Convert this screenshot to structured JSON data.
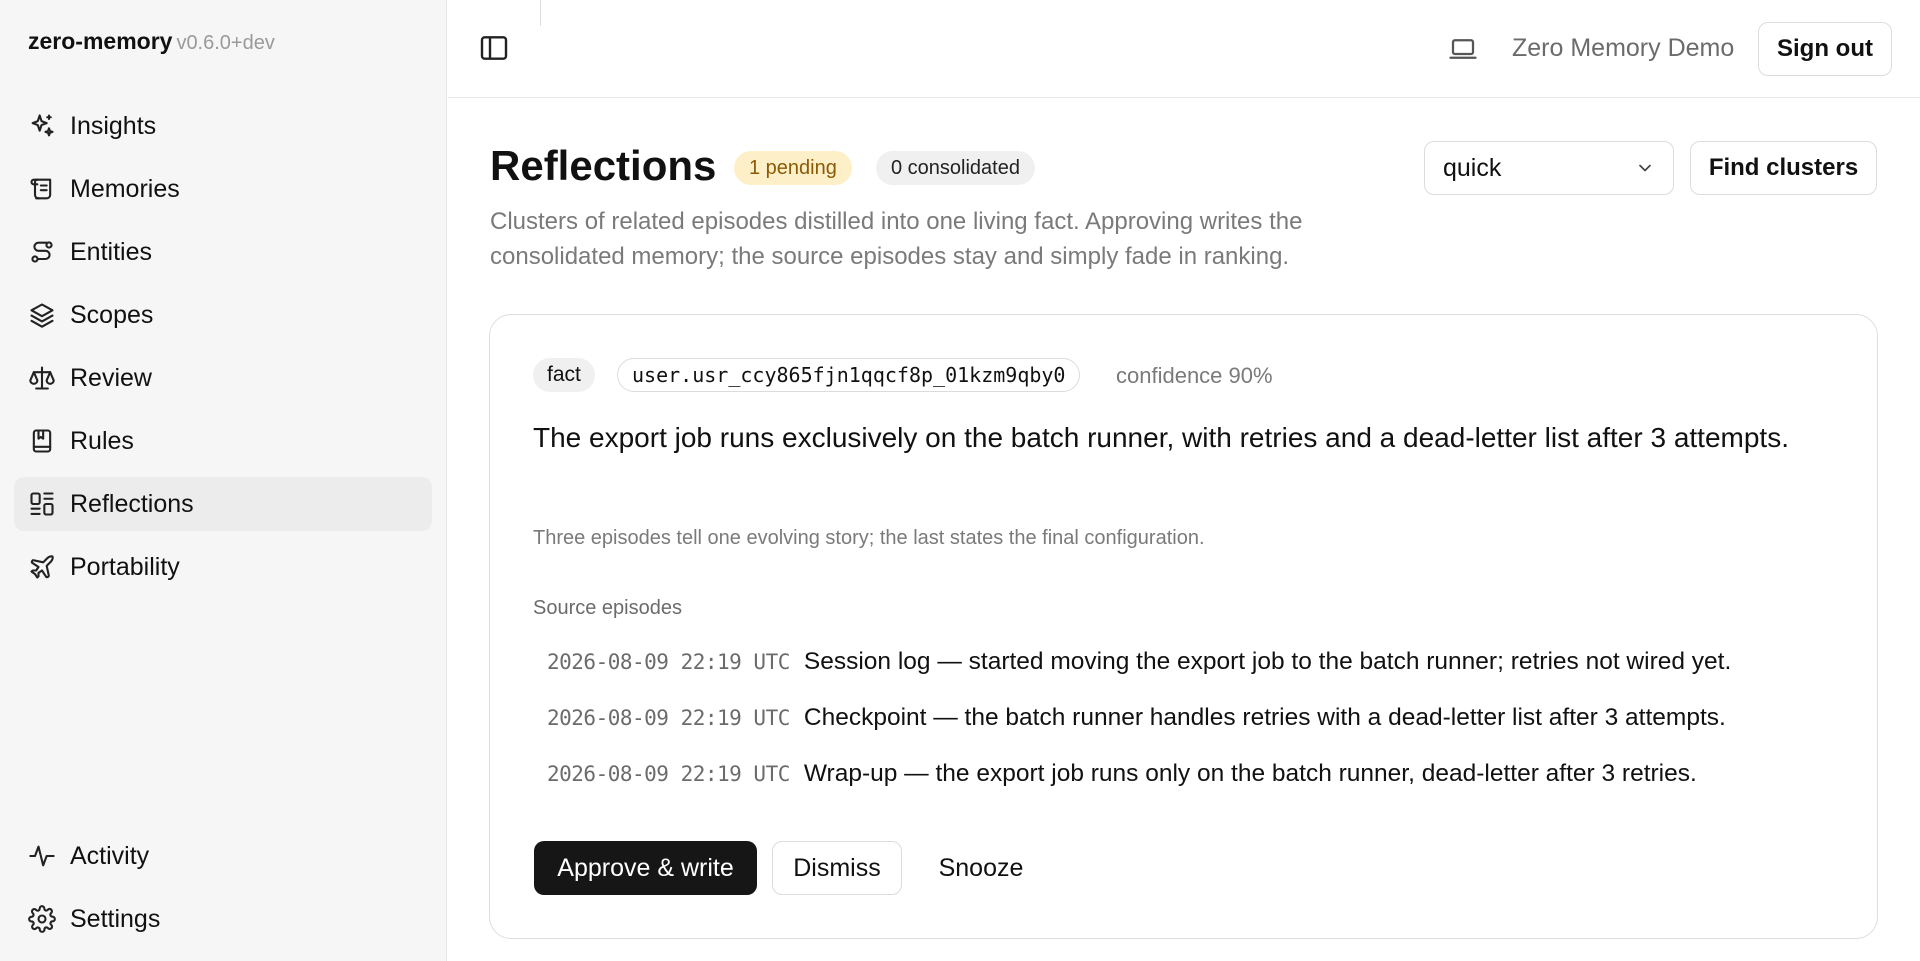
{
  "app": {
    "name": "zero-memory",
    "version": "v0.6.0+dev"
  },
  "sidebar": {
    "items": [
      {
        "label": "Insights",
        "icon": "sparkles-icon"
      },
      {
        "label": "Memories",
        "icon": "scroll-icon"
      },
      {
        "label": "Entities",
        "icon": "route-icon"
      },
      {
        "label": "Scopes",
        "icon": "layers-icon"
      },
      {
        "label": "Review",
        "icon": "scale-icon"
      },
      {
        "label": "Rules",
        "icon": "book-icon"
      },
      {
        "label": "Reflections",
        "icon": "grid-icon",
        "active": true
      },
      {
        "label": "Portability",
        "icon": "plane-icon"
      }
    ],
    "footer_items": [
      {
        "label": "Activity",
        "icon": "activity-icon"
      },
      {
        "label": "Settings",
        "icon": "gear-icon"
      }
    ]
  },
  "header": {
    "user_name": "Zero Memory Demo",
    "sign_out_label": "Sign out",
    "icons": [
      "sidebar-toggle-icon",
      "laptop-icon"
    ]
  },
  "page": {
    "title": "Reflections",
    "badge_pending": "1 pending",
    "badge_consolidated": "0 consolidated",
    "subtitle": "Clusters of related episodes distilled into one living fact. Approving writes the consolidated memory; the source episodes stay and simply fade in ranking.",
    "mode_select": "quick",
    "find_button": "Find clusters"
  },
  "card": {
    "type": "fact",
    "scope": "user.usr_ccy865fjn1qqcf8p_01kzm9qby0",
    "confidence": "confidence 90%",
    "fact": "The export job runs exclusively on the batch runner, with retries and a dead-letter list after 3 attempts.",
    "rationale": "Three episodes tell one evolving story; the last states the final configuration.",
    "source_label": "Source episodes",
    "episodes": [
      {
        "time": "2026-08-09 22:19 UTC",
        "text": "Session log — started moving the export job to the batch runner; retries not wired yet."
      },
      {
        "time": "2026-08-09 22:19 UTC",
        "text": "Checkpoint — the batch runner handles retries with a dead-letter list after 3 attempts."
      },
      {
        "time": "2026-08-09 22:19 UTC",
        "text": "Wrap-up — the export job runs only on the batch runner, dead-letter after 3 retries."
      }
    ],
    "approve_label": "Approve & write",
    "dismiss_label": "Dismiss",
    "snooze_label": "Snooze"
  },
  "colors": {
    "sidebar_bg": "#f6f6f6",
    "active_item_bg": "#ececec",
    "pending_badge_bg": "#fdf0c8",
    "pending_badge_text": "#8a5a06",
    "primary_button": "#161616"
  }
}
